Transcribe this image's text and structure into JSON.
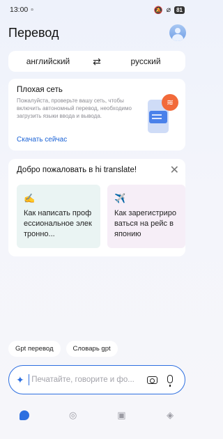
{
  "status": {
    "time": "13:00",
    "battery": "81"
  },
  "header": {
    "title": "Перевод"
  },
  "languages": {
    "source": "английский",
    "target": "русский"
  },
  "network_card": {
    "title": "Плохая сеть",
    "description": "Пожалуйста, проверьте вашу сеть, чтобы включить автономный перевод, необходимо загрузить языки ввода и вывода.",
    "action": "Скачать сейчас"
  },
  "welcome": {
    "title": "Добро пожаловать в hi translate!",
    "tips": [
      {
        "emoji": "✍️",
        "text": "Как написать профессиональное электронно..."
      },
      {
        "emoji": "✈️",
        "text": "Как зарегистрироваться на рейс в японию"
      }
    ]
  },
  "chips": [
    "Gpt перевод",
    "Словарь gpt"
  ],
  "input": {
    "placeholder": "Печатайте, говорите и фо..."
  },
  "colors": {
    "accent": "#2d6fe0",
    "warning": "#f26a3a"
  }
}
